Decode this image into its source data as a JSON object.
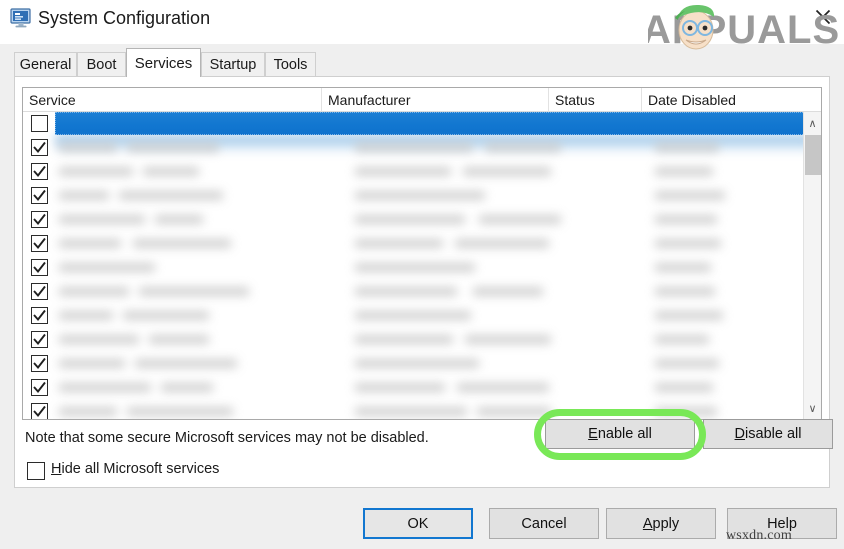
{
  "window": {
    "title": "System Configuration",
    "icon": "system-configuration-icon",
    "close_label": "✕"
  },
  "watermarks": {
    "brand": "APPUALS",
    "site": "wsxdn.com"
  },
  "tabs": [
    {
      "label": "General",
      "active": false
    },
    {
      "label": "Boot",
      "active": false
    },
    {
      "label": "Services",
      "active": true
    },
    {
      "label": "Startup",
      "active": false
    },
    {
      "label": "Tools",
      "active": false
    }
  ],
  "table": {
    "columns": [
      {
        "label": "Service"
      },
      {
        "label": "Manufacturer"
      },
      {
        "label": "Status"
      },
      {
        "label": "Date Disabled"
      }
    ],
    "rows": [
      {
        "checked": false,
        "selected": true
      },
      {
        "checked": true,
        "selected": false
      },
      {
        "checked": true,
        "selected": false
      },
      {
        "checked": true,
        "selected": false
      },
      {
        "checked": true,
        "selected": false
      },
      {
        "checked": true,
        "selected": false
      },
      {
        "checked": true,
        "selected": false
      },
      {
        "checked": true,
        "selected": false
      },
      {
        "checked": true,
        "selected": false
      },
      {
        "checked": true,
        "selected": false
      },
      {
        "checked": true,
        "selected": false
      },
      {
        "checked": true,
        "selected": false
      },
      {
        "checked": true,
        "selected": false
      }
    ],
    "content_state": "blurred"
  },
  "scrollbar": {
    "up_arrow": "∧",
    "down_arrow": "∨",
    "thumb_position_pct": 2
  },
  "note": "Note that some secure Microsoft services may not be disabled.",
  "hide_checkbox": {
    "label_prefix": "H",
    "label_rest": "ide all Microsoft services",
    "checked": false
  },
  "service_buttons": {
    "enable_all_prefix": "E",
    "enable_all_rest": "nable all",
    "disable_all_prefix": "D",
    "disable_all_rest": "isable all",
    "highlight_color": "#79e857",
    "highlighted": "enable-all"
  },
  "footer_buttons": {
    "ok": "OK",
    "cancel": "Cancel",
    "apply_prefix": "A",
    "apply_rest": "pply",
    "help": "Help",
    "focused": "ok",
    "focus_color": "#1277d0"
  },
  "colors": {
    "selection_blue": "#1277d0",
    "dialog_bg": "#efefef",
    "panel_bg": "#ffffff",
    "button_face": "#e1e1e1"
  }
}
